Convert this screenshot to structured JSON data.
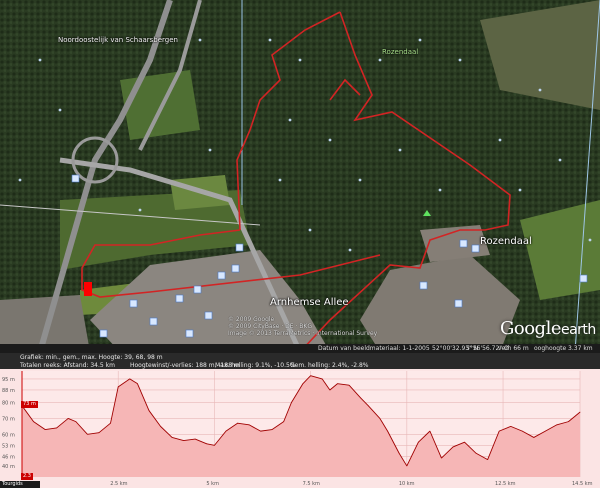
{
  "map": {
    "labels": {
      "noordoostelijk": "Noordoostelijk van Schaarsbergen",
      "rozendaal_top": "Rozendaal",
      "rozendaal": "Rozendaal",
      "arnhemse_allee": "Arnhemse Allee"
    },
    "attribution": {
      "line1": "© 2009 Google",
      "line2": "© 2009 CityBase · DE · BKG",
      "line3": "Image © 2013 TerraMetrics · International Survey"
    },
    "logo": {
      "google": "Google",
      "earth": "earth"
    },
    "route_color": "#d22424",
    "marker_color": "#ff0000"
  },
  "statusbar": {
    "date": "Datum van beeldmateriaal: 1-1-2005",
    "lat": "52°00'32.93\" N",
    "lon": "5°56'56.72\" O",
    "elev": "verh 66 m",
    "eye": "ooghoogte 3.37 km"
  },
  "profile": {
    "graph_label": "Grafiek: min., gem., max. Hoogte: 39, 68, 98 m",
    "totals": "Totalen reeks: Afstand: 34.5 km",
    "gain": "Hoogtewinst/-verlies: 188 m, -188 m",
    "max_slope": "Max. helling: 9.1%, -10.5%",
    "avg_slope": "Gem. helling: 2.4%, -2.8%",
    "marker_top": "73 m",
    "marker_bottom": "2.3"
  },
  "tourplayer_label": "Tourgids",
  "chart_data": {
    "type": "area",
    "title": "",
    "xlabel": "",
    "ylabel": "",
    "xlim": [
      0,
      14.5
    ],
    "ylim": [
      33,
      100
    ],
    "grid": true,
    "fill_color": "#f6b6b6",
    "line_color": "#a00000",
    "y_ticks": [
      {
        "value": 95,
        "label": "95 m"
      },
      {
        "value": 88,
        "label": "88 m"
      },
      {
        "value": 80,
        "label": "80 m"
      },
      {
        "value": 70,
        "label": "70 m"
      },
      {
        "value": 60,
        "label": "60 m"
      },
      {
        "value": 53,
        "label": "53 m"
      },
      {
        "value": 46,
        "label": "46 m"
      },
      {
        "value": 40,
        "label": "40 m"
      }
    ],
    "x_ticks": [
      {
        "value": 2.5,
        "label": "2.5 km"
      },
      {
        "value": 5,
        "label": "5 km"
      },
      {
        "value": 7.5,
        "label": "7.5 km"
      },
      {
        "value": 10,
        "label": "10 km"
      },
      {
        "value": 12.5,
        "label": "12.5 km"
      },
      {
        "value": 14.5,
        "label": "14.5 km"
      }
    ],
    "series": [
      {
        "x": [
          0.0,
          0.3,
          0.6,
          0.9,
          1.2,
          1.4,
          1.7,
          2.0,
          2.3,
          2.5,
          2.8,
          3.0,
          3.3,
          3.6,
          3.9,
          4.2,
          4.5,
          4.8,
          5.0,
          5.3,
          5.6,
          5.9,
          6.2,
          6.5,
          6.8,
          7.0,
          7.3,
          7.5,
          7.8,
          8.0,
          8.2,
          8.5,
          8.8,
          9.0,
          9.3,
          9.5,
          9.8,
          10.0,
          10.3,
          10.6,
          10.9,
          11.2,
          11.5,
          11.8,
          12.1,
          12.4,
          12.7,
          13.0,
          13.3,
          13.6,
          13.9,
          14.2,
          14.5
        ],
        "y": [
          78,
          68,
          63,
          64,
          70,
          68,
          60,
          61,
          67,
          90,
          95,
          92,
          75,
          65,
          58,
          56,
          57,
          54,
          53,
          62,
          67,
          66,
          62,
          63,
          68,
          80,
          92,
          97,
          95,
          88,
          92,
          91,
          83,
          78,
          70,
          62,
          48,
          40,
          55,
          62,
          45,
          52,
          55,
          48,
          44,
          62,
          65,
          62,
          58,
          62,
          66,
          68,
          74
        ]
      }
    ]
  }
}
